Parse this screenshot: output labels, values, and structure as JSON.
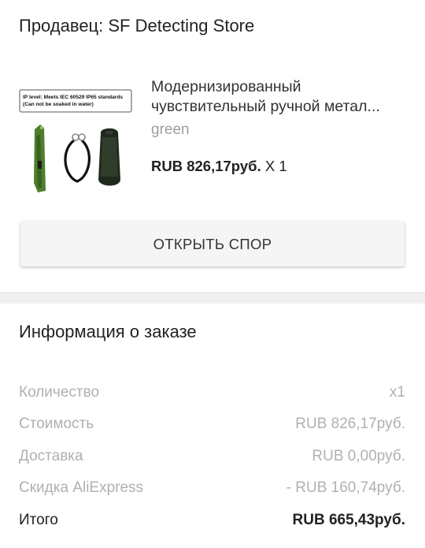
{
  "seller": {
    "label": "Продавец: SF Detecting Store"
  },
  "product": {
    "image_caption_line1": "IP level: Meets IEC 60529 IP65 standards",
    "image_caption_line2": "(Can not be soaked in water)",
    "title_line1": "Модернизированный",
    "title_line2": "чувствительный ручной метал...",
    "variant": "green",
    "price": "RUB 826,17руб.",
    "quantity": "X 1",
    "color_green": "#4a7a2a"
  },
  "actions": {
    "dispute_label": "ОТКРЫТЬ СПОР"
  },
  "order_info": {
    "title": "Информация о заказе",
    "rows": [
      {
        "label": "Количество",
        "value": "x1"
      },
      {
        "label": "Стоимость",
        "value": "RUB 826,17руб."
      },
      {
        "label": "Доставка",
        "value": "RUB 0,00руб."
      },
      {
        "label": "Скидка AliExpress",
        "value": "- RUB 160,74руб."
      },
      {
        "label": "Итого",
        "value": "RUB 665,43руб."
      }
    ]
  }
}
